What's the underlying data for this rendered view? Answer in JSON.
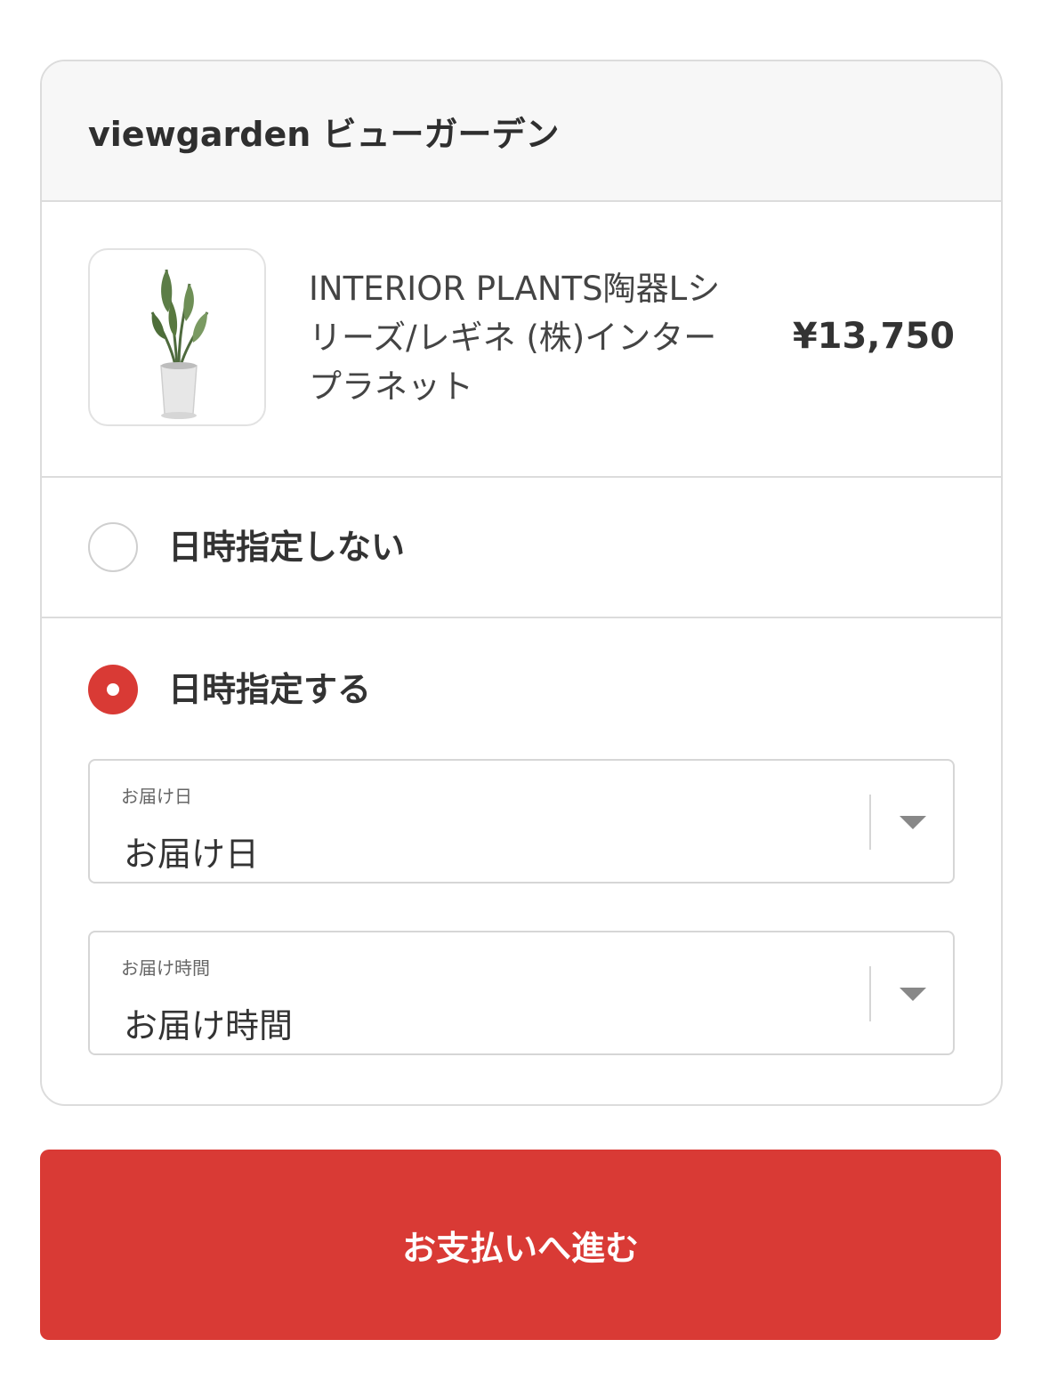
{
  "shop": {
    "name": "viewgarden ビューガーデン"
  },
  "product": {
    "name": "INTERIOR PLANTS陶器Lシリーズ/レギネ (株)インタープラネット",
    "price": "¥13,750",
    "image_icon": "potted-plant-icon"
  },
  "delivery_options": {
    "no_date": {
      "label": "日時指定しない",
      "selected": false
    },
    "with_date": {
      "label": "日時指定する",
      "selected": true
    }
  },
  "date_select": {
    "floating_label": "お届け日",
    "value": "お届け日"
  },
  "time_select": {
    "floating_label": "お届け時間",
    "value": "お届け時間"
  },
  "pay_button": {
    "label": "お支払いへ進む"
  },
  "colors": {
    "accent": "#d93a35",
    "border": "#dcdcdc",
    "header_bg": "#f7f7f7"
  }
}
